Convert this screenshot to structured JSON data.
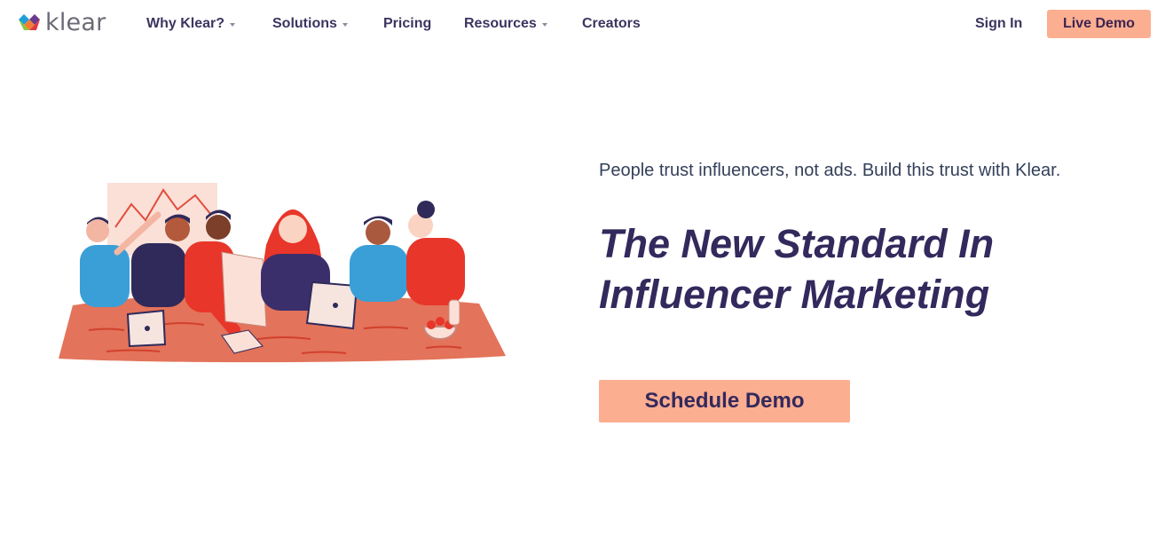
{
  "brand": {
    "name": "klear",
    "logo_icon": "klear-diamond-logo"
  },
  "nav": {
    "items": [
      {
        "label": "Why Klear?",
        "has_dropdown": true
      },
      {
        "label": "Solutions",
        "has_dropdown": true
      },
      {
        "label": "Pricing",
        "has_dropdown": false
      },
      {
        "label": "Resources",
        "has_dropdown": true
      },
      {
        "label": "Creators",
        "has_dropdown": false
      }
    ],
    "sign_in": "Sign In",
    "live_demo": "Live Demo"
  },
  "hero": {
    "tagline": "People trust influencers, not ads. Build this trust with Klear.",
    "headline_line1": "The New Standard In",
    "headline_line2": "Influencer Marketing",
    "cta": "Schedule Demo",
    "illustration": "team-meeting-illustration"
  },
  "colors": {
    "accent": "#fcae91",
    "heading": "#33295c",
    "nav_text": "#3b3560",
    "table": "#e3735a",
    "red": "#e8362a",
    "blue": "#3a9fd6",
    "navy": "#2f2a5a"
  }
}
